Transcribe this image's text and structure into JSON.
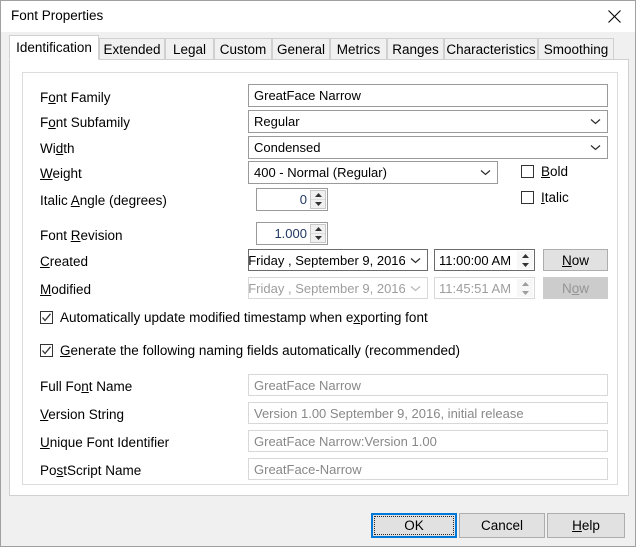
{
  "window": {
    "title": "Font Properties",
    "close_icon": "close-icon"
  },
  "tabs": [
    {
      "label": "Identification",
      "selected": true
    },
    {
      "label": "Extended",
      "selected": false
    },
    {
      "label": "Legal",
      "selected": false
    },
    {
      "label": "Custom",
      "selected": false
    },
    {
      "label": "General",
      "selected": false
    },
    {
      "label": "Metrics",
      "selected": false
    },
    {
      "label": "Ranges",
      "selected": false
    },
    {
      "label": "Characteristics",
      "selected": false
    },
    {
      "label": "Smoothing",
      "selected": false
    }
  ],
  "group": {
    "legend": "Identification"
  },
  "fields": {
    "font_family": {
      "label_pre": "F",
      "label_acc": "o",
      "label_post": "nt Family",
      "label_full": "Font Family",
      "value": "GreatFace Narrow"
    },
    "font_subfamily": {
      "label_pre": "F",
      "label_acc": "o",
      "label_post": "nt Subfamily",
      "label_full": "Font Subfamily",
      "value": "Regular"
    },
    "width": {
      "label_pre": "Wi",
      "label_acc": "d",
      "label_post": "th",
      "label_full": "Width",
      "value": "Condensed"
    },
    "weight": {
      "label_pre": "",
      "label_acc": "W",
      "label_post": "eight",
      "label_full": "Weight",
      "value": "400 - Normal (Regular)"
    },
    "italic_angle": {
      "label_pre": "Italic ",
      "label_acc": "A",
      "label_post": "ngle (degrees)",
      "label_full": "Italic Angle (degrees)",
      "value": "0"
    },
    "font_revision": {
      "label_pre": "Font ",
      "label_acc": "R",
      "label_post": "evision",
      "label_full": "Font Revision",
      "value": "1.000"
    },
    "created": {
      "label_pre": "",
      "label_acc": "C",
      "label_post": "reated",
      "label_full": "Created",
      "date": "Friday    , September  9, 2016",
      "time": "11:00:00 AM",
      "now_label_pre": "",
      "now_label_acc": "N",
      "now_label_post": "ow",
      "now_label_full": "Now",
      "disabled": false
    },
    "modified": {
      "label_pre": "",
      "label_acc": "M",
      "label_post": "odified",
      "label_full": "Modified",
      "date": "Friday    , September  9, 2016",
      "time": "11:45:51 AM",
      "now_label_pre": "N",
      "now_label_acc": "o",
      "now_label_post": "w",
      "now_label_full": "Now",
      "disabled": true
    },
    "full_font_name": {
      "label_pre": "Full Fo",
      "label_acc": "n",
      "label_post": "t Name",
      "label_full": "Full Font Name",
      "value": "GreatFace Narrow"
    },
    "version_string": {
      "label_pre": "",
      "label_acc": "V",
      "label_post": "ersion String",
      "label_full": "Version String",
      "value": "Version 1.00 September 9, 2016, initial release"
    },
    "unique_font_identifier": {
      "label_pre": "",
      "label_acc": "U",
      "label_post": "nique Font Identifier",
      "label_full": "Unique Font Identifier",
      "value": "GreatFace Narrow:Version 1.00"
    },
    "postscript_name": {
      "label_pre": "Po",
      "label_acc": "s",
      "label_post": "tScript Name",
      "label_full": "PostScript Name",
      "value": "GreatFace-Narrow"
    }
  },
  "checkboxes": {
    "bold": {
      "label_pre": "",
      "label_acc": "B",
      "label_post": "old",
      "label_full": "Bold",
      "checked": false
    },
    "italic": {
      "label_pre": "",
      "label_acc": "I",
      "label_post": "talic",
      "label_full": "Italic",
      "checked": false
    },
    "auto_update_timestamp": {
      "label_pre": "Automatically update modified timestamp when e",
      "label_acc": "x",
      "label_post": "porting font",
      "label_full": "Automatically update modified timestamp when exporting font",
      "checked": true
    },
    "generate_naming": {
      "label_pre": "",
      "label_acc": "G",
      "label_post": "enerate the following naming fields automatically (recommended)",
      "label_full": "Generate the following naming fields automatically (recommended)",
      "checked": true
    }
  },
  "footer": {
    "ok": {
      "label_full": "OK",
      "label_pre": "OK",
      "label_acc": "",
      "label_post": ""
    },
    "cancel": {
      "label_full": "Cancel",
      "label_pre": "Cancel",
      "label_acc": "",
      "label_post": ""
    },
    "help": {
      "label_full": "Help",
      "label_pre": "",
      "label_acc": "H",
      "label_post": "elp"
    }
  },
  "colors": {
    "accent": "#0078d7",
    "spin_value": "#1f3864",
    "readonly_text": "#888888",
    "disabled_text": "#9d9d9d",
    "window_bg": "#f0f0f0",
    "page_bg": "#ffffff"
  }
}
